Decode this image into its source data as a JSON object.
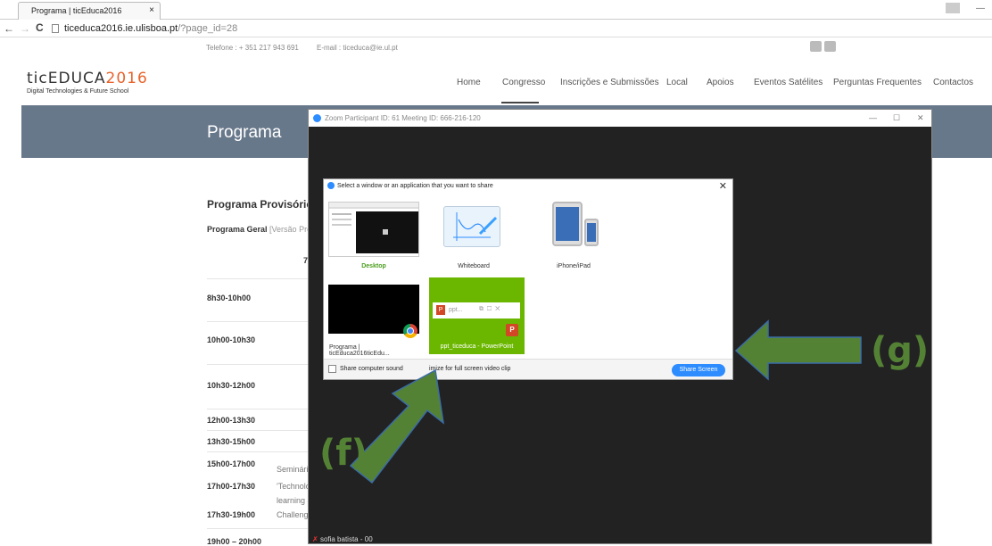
{
  "browser": {
    "tab_title": "Programa | ticEduca2016",
    "tab_close": "×",
    "url_host": "ticeduca2016.ie.ulisboa.pt",
    "url_path": "/?page_id=28"
  },
  "site": {
    "phone": "Telefone : + 351 217 943 691",
    "email": "E-mail : ticeduca@ie.ul.pt",
    "logo_main": "ticEDUCA",
    "logo_year": "2016",
    "logo_sub": "Digital Technologies & Future School",
    "nav": [
      "Home",
      "Congresso",
      "Inscrições e Submissões",
      "Local",
      "Apoios",
      "Eventos Satélites",
      "Perguntas Frequentes",
      "Contactos"
    ],
    "active_nav": "Congresso",
    "banner_title": "Programa",
    "section_title": "Programa Provisório",
    "general_label": "Programa Geral",
    "general_link": "[Versão Prov",
    "day_label": "7",
    "rows": [
      "8h30-10h00",
      "10h00-10h30",
      "10h30-12h00",
      "12h00-13h30",
      "13h30-15h00",
      "15h00-17h00",
      "17h00-17h30",
      "17h30-19h00",
      "19h00 – 20h00"
    ],
    "row_notes": [
      "Seminário",
      "'Technolo",
      "learning &",
      "Challenge"
    ]
  },
  "zoom": {
    "window_title": "Zoom Participant ID: 61   Meeting ID: 666-216-120",
    "participant": "sofia batista - 00"
  },
  "share_dialog": {
    "title": "Select a window or an application that you want to share",
    "tiles": [
      {
        "label": "Desktop",
        "icon": "desktop-preview"
      },
      {
        "label": "Whiteboard",
        "icon": "whiteboard-icon"
      },
      {
        "label": "iPhone/iPad",
        "icon": "ipad-iphone-icon"
      },
      {
        "label": "Programa | ticEduca2016ticEdu...",
        "icon": "chrome-icon"
      },
      {
        "label": "ppt_ticeduca - PowerPoint",
        "icon": "powerpoint-icon"
      }
    ],
    "ppt_mini_label": "ppt...",
    "share_sound": "Share computer sound",
    "optimize": "imize for full screen video clip",
    "share_button": "Share Screen"
  },
  "annotations": {
    "f": "(f)",
    "g": "(g)"
  },
  "colors": {
    "zoom_blue": "#2d8cff",
    "annotation_green": "#548235",
    "selected_tile": "#6bb700",
    "banner": "#68788b"
  }
}
